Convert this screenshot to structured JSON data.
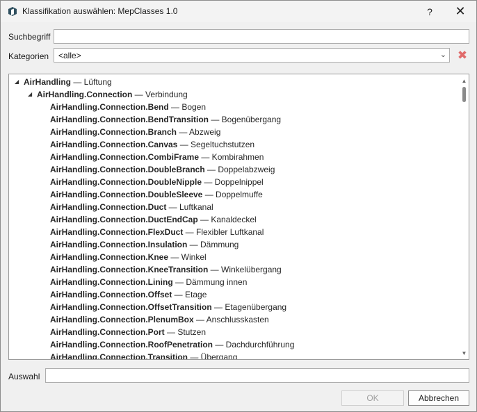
{
  "window": {
    "title": "Klassifikation auswählen: MepClasses 1.0",
    "help_glyph": "?",
    "close_glyph": "✕"
  },
  "search": {
    "label": "Suchbegriff",
    "value": ""
  },
  "categories": {
    "label": "Kategorien",
    "value": "<alle>",
    "arrow": "⌄",
    "clear_glyph": "✖"
  },
  "tree": {
    "rows": [
      {
        "level": 0,
        "expander": "◢",
        "name": "AirHandling",
        "desc": " — Lüftung"
      },
      {
        "level": 1,
        "expander": "◢",
        "name": "AirHandling.Connection",
        "desc": " — Verbindung"
      },
      {
        "level": 2,
        "name": "AirHandling.Connection.Bend",
        "desc": " — Bogen"
      },
      {
        "level": 2,
        "name": "AirHandling.Connection.BendTransition",
        "desc": " — Bogenübergang"
      },
      {
        "level": 2,
        "name": "AirHandling.Connection.Branch",
        "desc": " — Abzweig"
      },
      {
        "level": 2,
        "name": "AirHandling.Connection.Canvas",
        "desc": " — Segeltuchstutzen"
      },
      {
        "level": 2,
        "name": "AirHandling.Connection.CombiFrame",
        "desc": " — Kombirahmen"
      },
      {
        "level": 2,
        "name": "AirHandling.Connection.DoubleBranch",
        "desc": " — Doppelabzweig"
      },
      {
        "level": 2,
        "name": "AirHandling.Connection.DoubleNipple",
        "desc": " — Doppelnippel"
      },
      {
        "level": 2,
        "name": "AirHandling.Connection.DoubleSleeve",
        "desc": " — Doppelmuffe"
      },
      {
        "level": 2,
        "name": "AirHandling.Connection.Duct",
        "desc": " — Luftkanal"
      },
      {
        "level": 2,
        "name": "AirHandling.Connection.DuctEndCap",
        "desc": " — Kanaldeckel"
      },
      {
        "level": 2,
        "name": "AirHandling.Connection.FlexDuct",
        "desc": " — Flexibler Luftkanal"
      },
      {
        "level": 2,
        "name": "AirHandling.Connection.Insulation",
        "desc": " — Dämmung"
      },
      {
        "level": 2,
        "name": "AirHandling.Connection.Knee",
        "desc": " — Winkel"
      },
      {
        "level": 2,
        "name": "AirHandling.Connection.KneeTransition",
        "desc": " — Winkelübergang"
      },
      {
        "level": 2,
        "name": "AirHandling.Connection.Lining",
        "desc": " — Dämmung innen"
      },
      {
        "level": 2,
        "name": "AirHandling.Connection.Offset",
        "desc": " — Etage"
      },
      {
        "level": 2,
        "name": "AirHandling.Connection.OffsetTransition",
        "desc": " — Etagenübergang"
      },
      {
        "level": 2,
        "name": "AirHandling.Connection.PlenumBox",
        "desc": " — Anschlusskasten"
      },
      {
        "level": 2,
        "name": "AirHandling.Connection.Port",
        "desc": " — Stutzen"
      },
      {
        "level": 2,
        "name": "AirHandling.Connection.RoofPenetration",
        "desc": " — Dachdurchführung"
      },
      {
        "level": 2,
        "name": "AirHandling.Connection.Transition",
        "desc": " — Übergang"
      }
    ],
    "scroll_up_glyph": "▲",
    "scroll_down_glyph": "▼"
  },
  "selection": {
    "label": "Auswahl",
    "value": ""
  },
  "buttons": {
    "ok": "OK",
    "cancel": "Abbrechen"
  }
}
